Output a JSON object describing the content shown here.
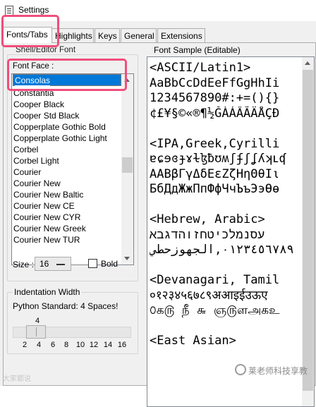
{
  "window": {
    "title": "Settings"
  },
  "tabs": [
    {
      "label": "Fonts/Tabs",
      "active": true
    },
    {
      "label": "Highlights"
    },
    {
      "label": "Keys"
    },
    {
      "label": "General"
    },
    {
      "label": "Extensions"
    }
  ],
  "shell_editor_font": {
    "group_label": "Shell/Editor Font",
    "font_face_label": "Font Face :",
    "selected_font": "Consolas",
    "font_list": [
      "Constantia",
      "Cooper Black",
      "Cooper Std Black",
      "Copperplate Gothic Bold",
      "Copperplate Gothic Light",
      "Corbel",
      "Corbel Light",
      "Courier",
      "Courier New",
      "Courier New Baltic",
      "Courier New CE",
      "Courier New CYR",
      "Courier New Greek",
      "Courier New TUR"
    ],
    "size_label": "Size :",
    "size_value": "16",
    "bold_label": "Bold",
    "bold_checked": false
  },
  "indentation": {
    "title": "Indentation Width",
    "description": "Python Standard: 4 Spaces!",
    "value": "4",
    "ticks": [
      "2",
      "4",
      "6",
      "8",
      "10",
      "12",
      "14",
      "16"
    ]
  },
  "font_sample": {
    "label": "Font Sample (Editable)",
    "lines": [
      "<ASCII/Latin1>",
      "AaBbCcDdEeFfGgHhIi",
      "1234567890#:+=(){}",
      "¢£¥§©«®¶½ĞÀÁÂÃÄÅÇĐ",
      "",
      "<IPA,Greek,Cyrilli",
      "ɐɕɘɞɟɤɫɮƀʊʍʃʄʃʆʎʞʟʠ",
      "ΑΑΒβΓγΔδΕεΖζΗηΘθΙι",
      "БбДдЖжПпФфЧчЪъЭэѲѳ",
      "",
      "<Hebrew, Arabic>",
      "עסנמלכיטחזוהדגבא",
      "٠١٢٣٤٥٦٧٨٩,الجهوزحطي",
      "",
      "<Devanagari, Tamil",
      "०१२३४५६७८९अआइईउऊए",
      "௦க௫ நீ ௬ ஞ௫ளஅகஉ",
      "",
      "<East Asian>"
    ]
  },
  "watermark": {
    "left": "大家都说",
    "right": "莱老师科技享教"
  },
  "colors": {
    "selection": "#0078d7",
    "highlight_border": "#f04e7c",
    "window_bg": "#f0f0f0"
  }
}
